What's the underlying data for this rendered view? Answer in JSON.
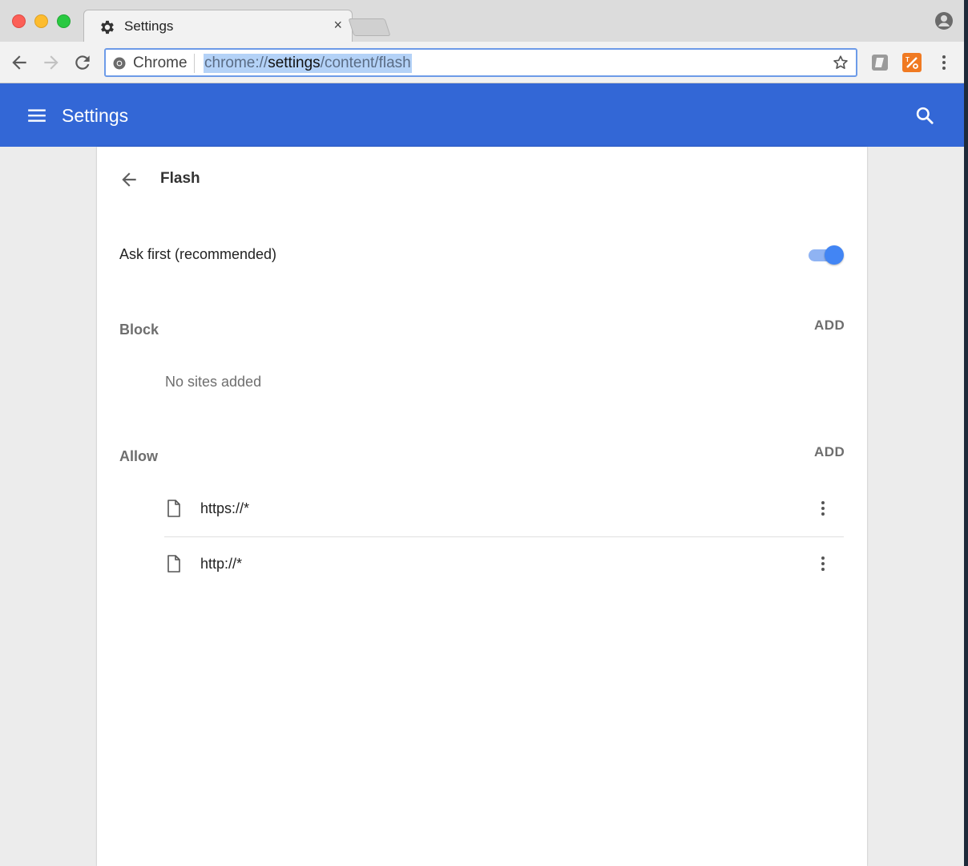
{
  "tab": {
    "title": "Settings",
    "close": "×"
  },
  "toolbar": {
    "omnibox_chip": "Chrome",
    "url_scheme": "chrome://",
    "url_host": "settings",
    "url_path": "/content/flash"
  },
  "appbar": {
    "title": "Settings"
  },
  "page": {
    "title": "Flash",
    "ask_first_label": "Ask first (recommended)",
    "ask_first_enabled": true,
    "block": {
      "heading": "Block",
      "add_label": "ADD",
      "empty_text": "No sites added"
    },
    "allow": {
      "heading": "Allow",
      "add_label": "ADD",
      "sites": [
        {
          "url": "https://*"
        },
        {
          "url": "http://*"
        }
      ]
    }
  },
  "colors": {
    "appbar": "#3367d6",
    "toggle_on": "#4285f4",
    "extension_orange": "#f07a22"
  },
  "icons": {
    "tab": "gear-icon",
    "nav_back": "arrow-back-icon",
    "nav_forward": "arrow-forward-icon",
    "reload": "reload-icon",
    "bookmark": "star-icon",
    "profile": "person-icon",
    "menu": "more-vertical-icon",
    "appbar_menu": "hamburger-icon",
    "appbar_search": "search-icon",
    "site": "file-icon"
  }
}
